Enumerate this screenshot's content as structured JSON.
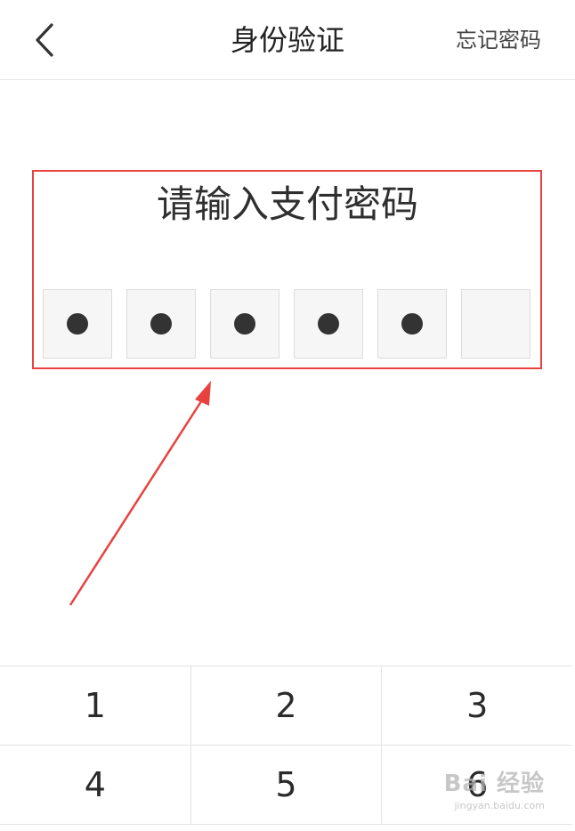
{
  "header": {
    "back_icon": "chevron-left-icon",
    "title": "身份验证",
    "forgot_label": "忘记密码"
  },
  "prompt": "请输入支付密码",
  "pin": {
    "length": 6,
    "filled": 5,
    "slots": [
      "●",
      "●",
      "●",
      "●",
      "●",
      ""
    ]
  },
  "annotation": {
    "highlight_color": "#e8423f",
    "arrow_color": "#e8423f"
  },
  "keypad": {
    "rows": [
      [
        "1",
        "2",
        "3"
      ],
      [
        "4",
        "5",
        "6"
      ]
    ]
  },
  "watermark": {
    "main": "Bai 经验",
    "sub": "jingyan.baidu.com"
  }
}
